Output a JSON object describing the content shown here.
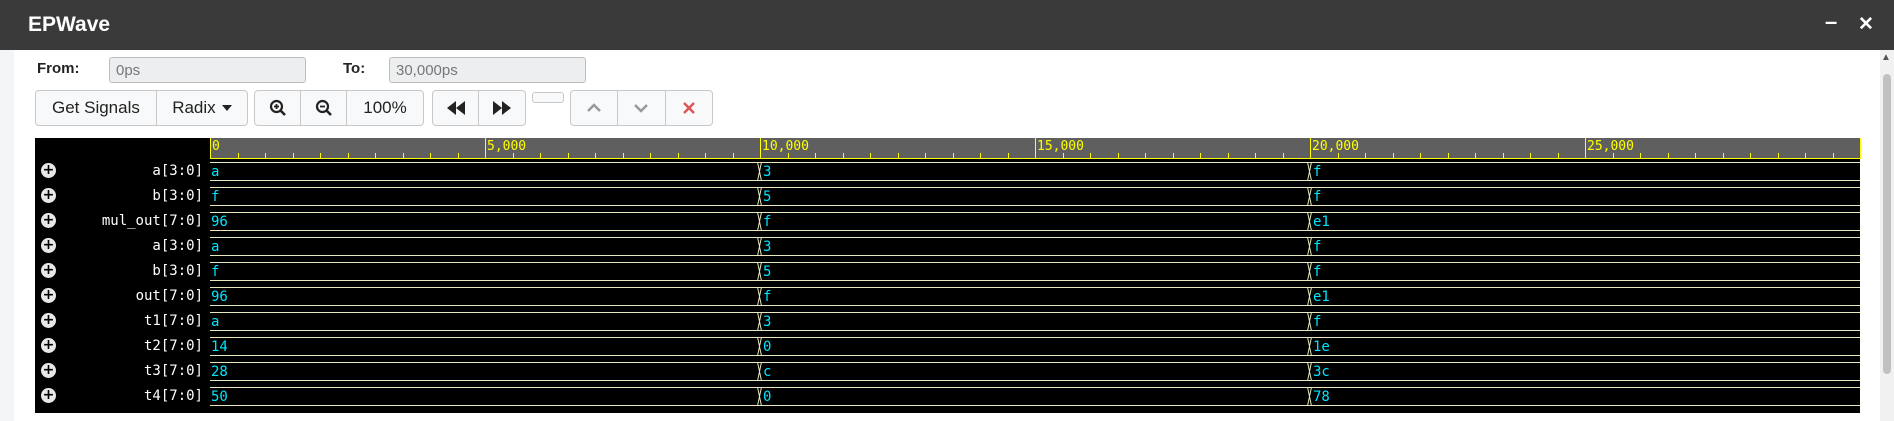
{
  "window": {
    "title": "EPWave",
    "minimize": "–",
    "close": "✕"
  },
  "range": {
    "from_label": "From:",
    "from_value": "0ps",
    "to_label": "To:",
    "to_value": "30,000ps"
  },
  "toolbar": {
    "get_signals": "Get Signals",
    "radix": "Radix",
    "zoom_in_icon": "zoom-in-icon",
    "zoom_out_icon": "zoom-out-icon",
    "zoom_level": "100%",
    "rewind_icon": "rewind-icon",
    "fast_forward_icon": "fast-forward-icon",
    "up_icon": "chevron-up-icon",
    "down_icon": "chevron-down-icon",
    "remove_icon": "close-icon"
  },
  "timeline": {
    "major_labels": [
      "0",
      "5,000",
      "10,000",
      "15,000",
      "20,000",
      "25,000"
    ],
    "max_ps": 30000,
    "transitions_ps": [
      10000,
      20000
    ]
  },
  "signals": [
    {
      "name": "a[3:0]",
      "values": [
        "a",
        "3",
        "f"
      ]
    },
    {
      "name": "b[3:0]",
      "values": [
        "f",
        "5",
        "f"
      ]
    },
    {
      "name": "mul_out[7:0]",
      "values": [
        "96",
        "f",
        "e1"
      ]
    },
    {
      "name": "a[3:0]",
      "values": [
        "a",
        "3",
        "f"
      ]
    },
    {
      "name": "b[3:0]",
      "values": [
        "f",
        "5",
        "f"
      ]
    },
    {
      "name": "out[7:0]",
      "values": [
        "96",
        "f",
        "e1"
      ]
    },
    {
      "name": "t1[7:0]",
      "values": [
        "a",
        "3",
        "f"
      ]
    },
    {
      "name": "t2[7:0]",
      "values": [
        "14",
        "0",
        "1e"
      ]
    },
    {
      "name": "t3[7:0]",
      "values": [
        "28",
        "c",
        "3c"
      ]
    },
    {
      "name": "t4[7:0]",
      "values": [
        "50",
        "0",
        "78"
      ]
    }
  ],
  "colors": {
    "ruler_text": "#ffff00",
    "value_text": "#00e5ff",
    "wave_line": "#e8e8c0",
    "background": "#000000"
  }
}
